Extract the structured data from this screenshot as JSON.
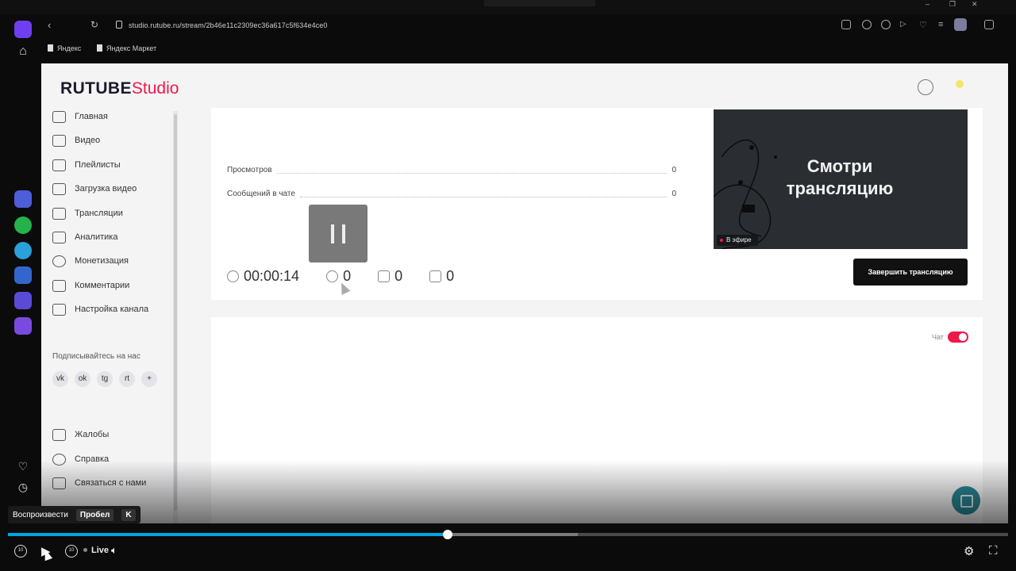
{
  "browser": {
    "url": "studio.rutube.ru/stream/2b46e11c2309ec36a617c5f634e4ce0",
    "bookmarks": [
      "Яндекс",
      "Яндекс Маркет"
    ]
  },
  "app": {
    "logo_main": "RUTUBE",
    "logo_accent": "Studio"
  },
  "nav": {
    "items": [
      {
        "label": "Главная",
        "icon": "home-icon"
      },
      {
        "label": "Видео",
        "icon": "video-icon"
      },
      {
        "label": "Плейлисты",
        "icon": "playlist-icon"
      },
      {
        "label": "Загрузка видео",
        "icon": "upload-icon"
      },
      {
        "label": "Трансляции",
        "icon": "broadcast-icon"
      },
      {
        "label": "Аналитика",
        "icon": "analytics-icon"
      },
      {
        "label": "Монетизация",
        "icon": "money-icon"
      },
      {
        "label": "Комментарии",
        "icon": "comments-icon"
      },
      {
        "label": "Настройка канала",
        "icon": "settings-icon"
      }
    ],
    "subscribe_label": "Подписывайтесь на нас",
    "social": [
      "vk",
      "ok",
      "tg",
      "rt",
      "+"
    ],
    "bottom_items": [
      {
        "label": "Жалобы",
        "icon": "flag-icon"
      },
      {
        "label": "Справка",
        "icon": "help-icon"
      },
      {
        "label": "Связаться с нами",
        "icon": "contact-icon"
      }
    ]
  },
  "stream": {
    "stats": [
      {
        "label": "Просмотров",
        "value": "0"
      },
      {
        "label": "Сообщений в чате",
        "value": "0"
      }
    ],
    "timer": "00:00:14",
    "viewers": "0",
    "likes": "0",
    "dislikes": "0",
    "preview_text": "Смотри трансляцию",
    "live_badge": "В эфире",
    "end_button": "Завершить трансляцию"
  },
  "chat": {
    "label": "Чат",
    "enabled": true,
    "accent_color": "#ed1a4a"
  },
  "player": {
    "tooltip_action": "Воспроизвести",
    "tooltip_key1": "Пробел",
    "tooltip_key2": "K",
    "live_label": "Live",
    "progress": 0.44,
    "buffered": 0.57,
    "rewind_label": "10",
    "forward_label": "10"
  }
}
